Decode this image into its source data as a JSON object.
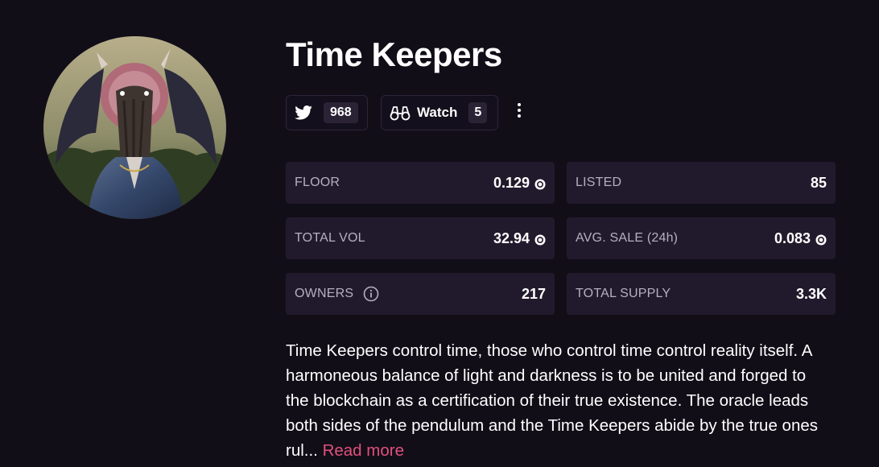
{
  "collection": {
    "title": "Time Keepers"
  },
  "social": {
    "twitter": {
      "icon": "twitter-icon",
      "count": "968"
    },
    "watch": {
      "icon": "binoculars-icon",
      "label": "Watch",
      "count": "5"
    }
  },
  "stats": [
    {
      "label": "FLOOR",
      "value": "0.129",
      "currency_icon": "sol-icon"
    },
    {
      "label": "LISTED",
      "value": "85"
    },
    {
      "label": "TOTAL VOL",
      "value": "32.94",
      "currency_icon": "sol-icon"
    },
    {
      "label": "AVG. SALE (24h)",
      "value": "0.083",
      "currency_icon": "sol-icon"
    },
    {
      "label": "OWNERS",
      "value": "217",
      "info_icon": "info-icon"
    },
    {
      "label": "TOTAL SUPPLY",
      "value": "3.3K"
    }
  ],
  "description": {
    "text": "Time Keepers control time, those who control time control reality itself. A harmoneous balance of light and darkness is to be united and forged to the blockchain as a certification of their true existence. The oracle leads both sides of the pendulum and the Time Keepers abide by the true ones rul...",
    "read_more": "Read more"
  },
  "colors": {
    "background": "#120e18",
    "card": "#211a2c",
    "accent": "#e0507c"
  }
}
